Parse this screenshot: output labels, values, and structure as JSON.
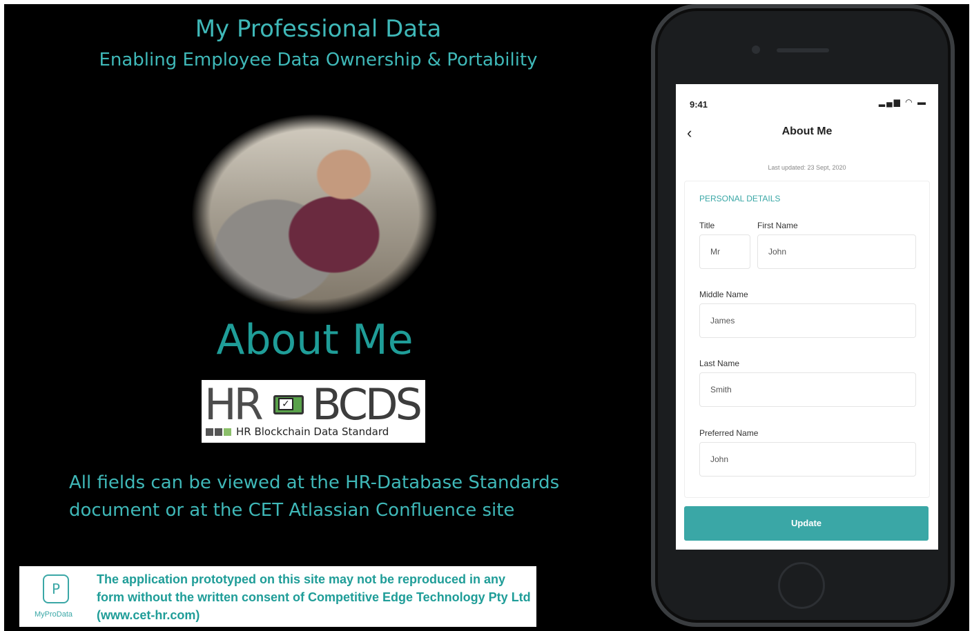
{
  "slide": {
    "title": "My Professional Data",
    "subtitle": "Enabling Employee Data Ownership & Portability",
    "heading": "About Me",
    "note": "All fields can be viewed at the HR-Database Standards document or at the CET Atlassian Confluence site",
    "logo": {
      "hr": "HR",
      "bcds": "BCDS",
      "tagline": "HR Blockchain Data Standard"
    },
    "footer": {
      "brand": "MyProData",
      "mark": "P",
      "text": "The application prototyped on this site may not be reproduced in any form without the written consent of Competitive Edge Technology Pty Ltd (www.cet-hr.com)"
    }
  },
  "app": {
    "status_time": "9:41",
    "status_icons": "signal-wifi-battery",
    "title": "About Me",
    "last_updated": "Last updated: 23 Sept, 2020",
    "section": "PERSONAL DETAILS",
    "fields": {
      "title_label": "Title",
      "title_value": "Mr",
      "first_name_label": "First Name",
      "first_name_value": "John",
      "middle_name_label": "Middle Name",
      "middle_name_value": "James",
      "last_name_label": "Last Name",
      "last_name_value": "Smith",
      "preferred_name_label": "Preferred Name",
      "preferred_name_value": "John"
    },
    "update_button": "Update"
  },
  "colors": {
    "accent": "#3aa7a6",
    "heading": "#1f9d98",
    "background": "#000000"
  }
}
